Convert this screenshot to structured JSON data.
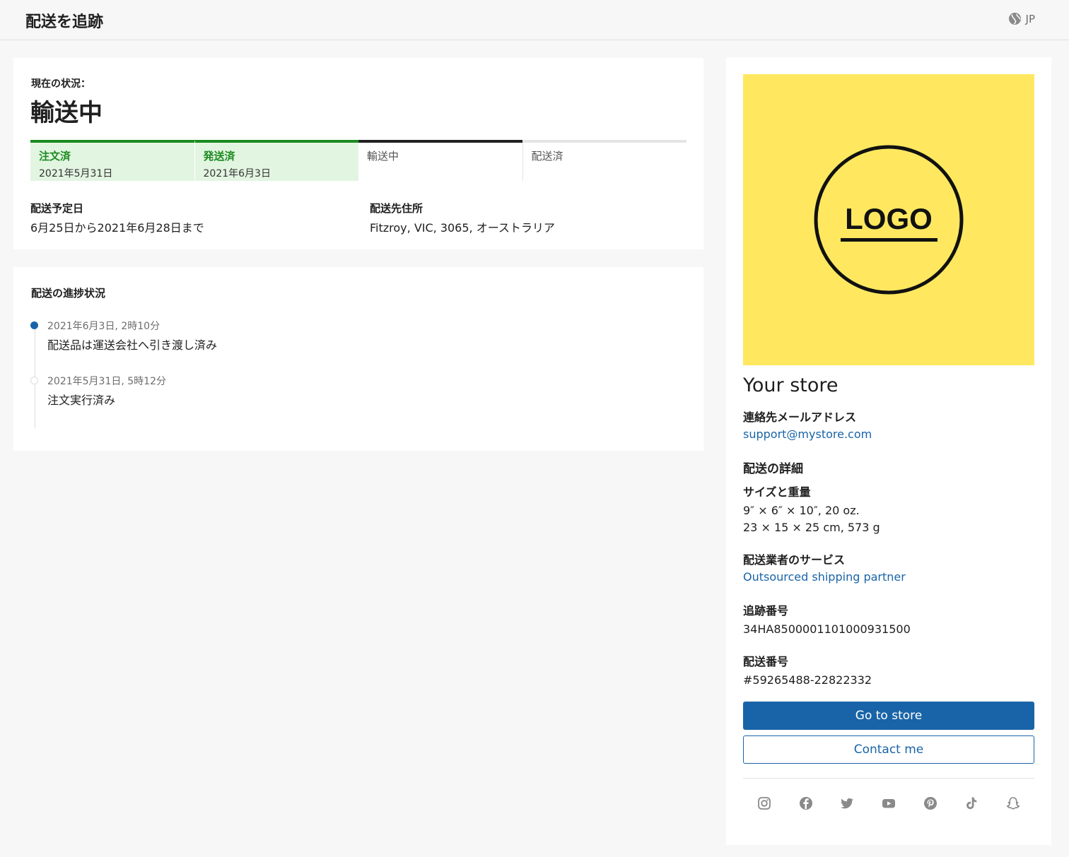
{
  "header": {
    "title": "配送を追跡",
    "language": "JP",
    "language_icon": "globe-icon"
  },
  "status": {
    "label": "現在の状況：",
    "value": "輸送中",
    "steps": [
      {
        "label": "注文済",
        "date": "2021年5月31日",
        "state": "done"
      },
      {
        "label": "発送済",
        "date": "2021年6月3日",
        "state": "done"
      },
      {
        "label": "輸送中",
        "date": "",
        "state": "current"
      },
      {
        "label": "配送済",
        "date": "",
        "state": "pending"
      }
    ],
    "delivery_estimate": {
      "title": "配送予定日",
      "value": "6月25日から2021年6月28日まで"
    },
    "delivery_address": {
      "title": "配送先住所",
      "value": "Fitzroy, VIC, 3065, オーストラリア"
    }
  },
  "progress": {
    "title": "配送の進捗状況",
    "events": [
      {
        "time": "2021年6月3日, 2時10分",
        "description": "配送品は運送会社へ引き渡し済み",
        "active": true
      },
      {
        "time": "2021年5月31日, 5時12分",
        "description": "注文実行済み",
        "active": false
      }
    ]
  },
  "store": {
    "logo_text": "LOGO",
    "name": "Your store",
    "contact_label": "連絡先メールアドレス",
    "contact_email": "support@mystore.com",
    "details_heading": "配送の詳細",
    "size_label": "サイズと重量",
    "size_imperial": "9″ × 6″ × 10″, 20 oz.",
    "size_metric": "23 × 15 × 25 cm, 573 g",
    "carrier_label": "配送業者のサービス",
    "carrier_value": "Outsourced shipping partner",
    "tracking_label": "追跡番号",
    "tracking_value": "34HA8500001101000931500",
    "shipment_label": "配送番号",
    "shipment_value": "#59265488-22822332",
    "go_to_store": "Go to store",
    "contact_me": "Contact me",
    "social_icons": [
      "instagram-icon",
      "facebook-icon",
      "twitter-icon",
      "youtube-icon",
      "pinterest-icon",
      "tiktok-icon",
      "snapchat-icon"
    ]
  },
  "colors": {
    "accent": "#1964a8",
    "done_green": "#1b8a1f",
    "done_bg": "#e2f5e1",
    "logo_bg": "#ffe85f",
    "page_bg": "#f7f7f7"
  }
}
